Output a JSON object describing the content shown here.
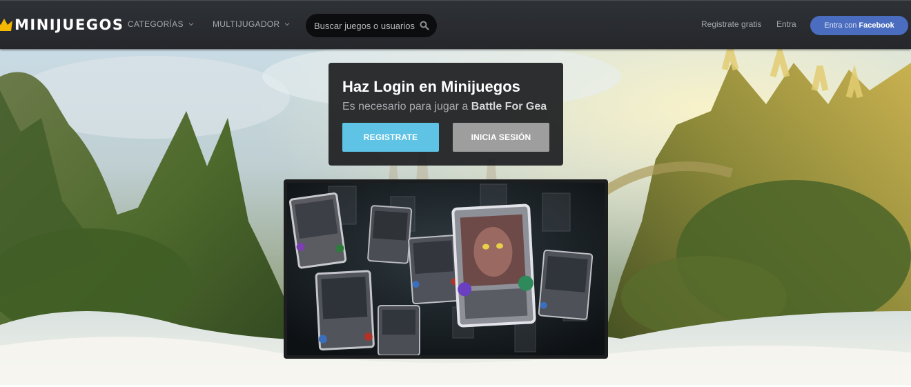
{
  "header": {
    "logo_text": "MINIJUEGOS",
    "nav": [
      {
        "label": "CATEGORÍAS"
      },
      {
        "label": "MULTIJUGADOR"
      }
    ],
    "search": {
      "placeholder": "Buscar juegos o usuarios"
    },
    "register_link": "Registrate gratis",
    "login_link": "Entra",
    "facebook_button": {
      "prefix": "Entra con",
      "brand": "Facebook"
    }
  },
  "login_panel": {
    "title": "Haz Login en Minijuegos",
    "subtitle_prefix": "Es necesario para jugar a",
    "game_name": "Battle For Gea",
    "register_button": "REGISTRATE",
    "login_button": "INICIA SESIÓN"
  },
  "colors": {
    "topbar": "#2a2c30",
    "logo_crown": "#f5b800",
    "register_button": "#5ec3e4",
    "login_button": "#9e9e9e",
    "facebook_button": "#4b6dbf"
  },
  "icons": {
    "logo": "crown-icon",
    "nav_dropdown": "chevron-down-icon",
    "search": "search-icon"
  }
}
